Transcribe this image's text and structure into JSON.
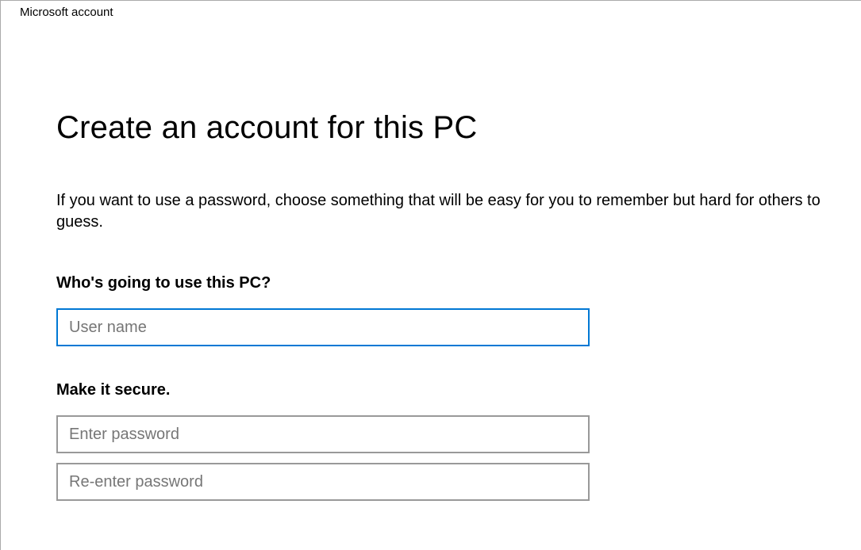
{
  "header": {
    "title": "Microsoft account"
  },
  "main": {
    "title": "Create an account for this PC",
    "description": "If you want to use a password, choose something that will be easy for you to remember but hard for others to guess.",
    "username": {
      "label": "Who's going to use this PC?",
      "placeholder": "User name",
      "value": ""
    },
    "password": {
      "label": "Make it secure.",
      "placeholder_enter": "Enter password",
      "placeholder_reenter": "Re-enter password",
      "value_enter": "",
      "value_reenter": ""
    }
  }
}
